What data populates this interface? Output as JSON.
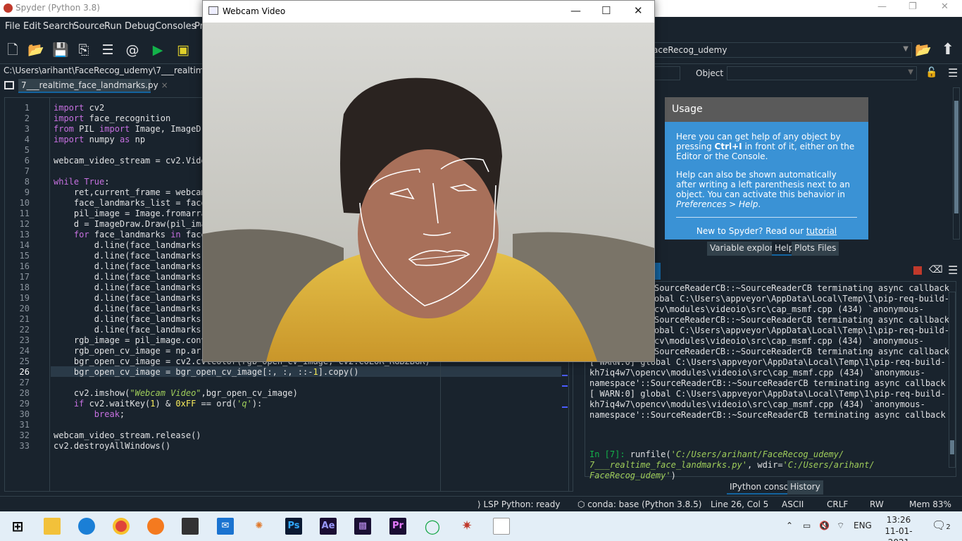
{
  "spyder": {
    "title": "Spyder (Python 3.8)",
    "menu": [
      "File",
      "Edit",
      "Search",
      "Source",
      "Run",
      "Debug",
      "Consoles",
      "Pr"
    ],
    "working_dir": "aceRecog_udemy",
    "path_strip": "C:\\Users\\arihant\\FaceRecog_udemy\\7___realtime_face_la",
    "editor_tab": "7___realtime_face_landmarks.py",
    "editor_tab_close": "×",
    "help": {
      "object_label": "Object",
      "usage_title": "Usage",
      "usage_p1_a": "Here you can get help of any object by pressing ",
      "usage_p1_b": "Ctrl+I",
      "usage_p1_c": " in front of it, either on the Editor or the Console.",
      "usage_p2_a": "Help can also be shown automatically after writing a left parenthesis next to an object. You can activate this behavior in ",
      "usage_p2_b": "Preferences > Help",
      "usage_p2_c": ".",
      "new_to": "New to Spyder? Read our ",
      "tutorial": "tutorial"
    },
    "right_tabs": [
      "Variable explorer",
      "Help",
      "Plots",
      "Files"
    ],
    "console_tabs": [
      "IPython console",
      "History"
    ],
    "status": {
      "lsp": "LSP Python: ready",
      "conda": "conda: base (Python 3.8.5)",
      "position": "Line 26, Col 5",
      "encoding": "ASCII",
      "eol": "CRLF",
      "perm": "RW",
      "mem": "Mem 83%"
    }
  },
  "code_lines": [
    "import cv2",
    "import face_recognition",
    "from PIL import Image, ImageDra",
    "import numpy as np",
    "",
    "webcam_video_stream = cv2.Video",
    "",
    "while True:",
    "    ret,current_frame = webcam",
    "    face_landmarks_list = face",
    "    pil_image = Image.fromarra",
    "    d = ImageDraw.Draw(pil_ima",
    "    for face_landmarks in face",
    "        d.line(face_landmarks[",
    "        d.line(face_landmarks[",
    "        d.line(face_landmarks[",
    "        d.line(face_landmarks[",
    "        d.line(face_landmarks[",
    "        d.line(face_landmarks[",
    "        d.line(face_landmarks[",
    "        d.line(face_landmarks[",
    "        d.line(face_landmarks[",
    "    rgb_image = pil_image.conve",
    "    rgb_open_cv_image = np.arra",
    "    bgr_open_cv_image = cv2.cvtColor(rgb_open_cv_image, cv2.COLOR_RGB2BGR)",
    "    bgr_open_cv_image = bgr_open_cv_image[:, :, ::-1].copy()",
    "",
    "    cv2.imshow(\"Webcam Video\",bgr_open_cv_image)",
    "    if cv2.waitKey(1) & 0xFF == ord('q'):",
    "        break;",
    "",
    "webcam_video_stream.release()",
    "cv2.destroyAllWindows()"
  ],
  "console_lines": [
    "SourceReaderCB::~SourceReaderCB terminating async callback",
    "obal C:\\Users\\appveyor\\AppData\\Local\\Temp\\1\\pip-req-build-",
    "cv\\modules\\videoio\\src\\cap_msmf.cpp (434) `anonymous-",
    "SourceReaderCB::~SourceReaderCB terminating async callback",
    "obal C:\\Users\\appveyor\\AppData\\Local\\Temp\\1\\pip-req-build-",
    "cv\\modules\\videoio\\src\\cap_msmf.cpp (434) `anonymous-",
    "SourceReaderCB::~SourceReaderCB terminating async callback",
    "[ WARN:0] global C:\\Users\\appveyor\\AppData\\Local\\Temp\\1\\pip-req-build-",
    "kh7iq4w7\\opencv\\modules\\videoio\\src\\cap_msmf.cpp (434) `anonymous-",
    "namespace'::SourceReaderCB::~SourceReaderCB terminating async callback",
    "[ WARN:0] global C:\\Users\\appveyor\\AppData\\Local\\Temp\\1\\pip-req-build-",
    "kh7iq4w7\\opencv\\modules\\videoio\\src\\cap_msmf.cpp (434) `anonymous-",
    "namespace'::SourceReaderCB::~SourceReaderCB terminating async callback"
  ],
  "console_prompt": {
    "prompt": "In [7]: ",
    "call": "runfile(",
    "arg1": "'C:/Users/arihant/FaceRecog_udemy/",
    "arg1b": "7___realtime_face_landmarks.py'",
    "sep": ", wdir=",
    "arg2": "'C:/Users/arihant/",
    "arg2b": "FaceRecog_udemy'",
    "close": ")"
  },
  "webcam": {
    "title": "Webcam Video"
  },
  "taskbar": {
    "lang": "ENG",
    "time": "13:26",
    "date": "11-01-2021",
    "notif_count": "2",
    "apps": [
      "File Explorer",
      "Edge",
      "Chrome",
      "Firefox",
      "Store",
      "Mail",
      "Spyder",
      "Ps",
      "Ae",
      "Ai-like",
      "Pr",
      "Refresh",
      "Anaconda",
      "Notepad"
    ]
  },
  "colors": {
    "bg": "#19232d",
    "accent": "#1464a0",
    "help_bg": "#3a92d5"
  }
}
